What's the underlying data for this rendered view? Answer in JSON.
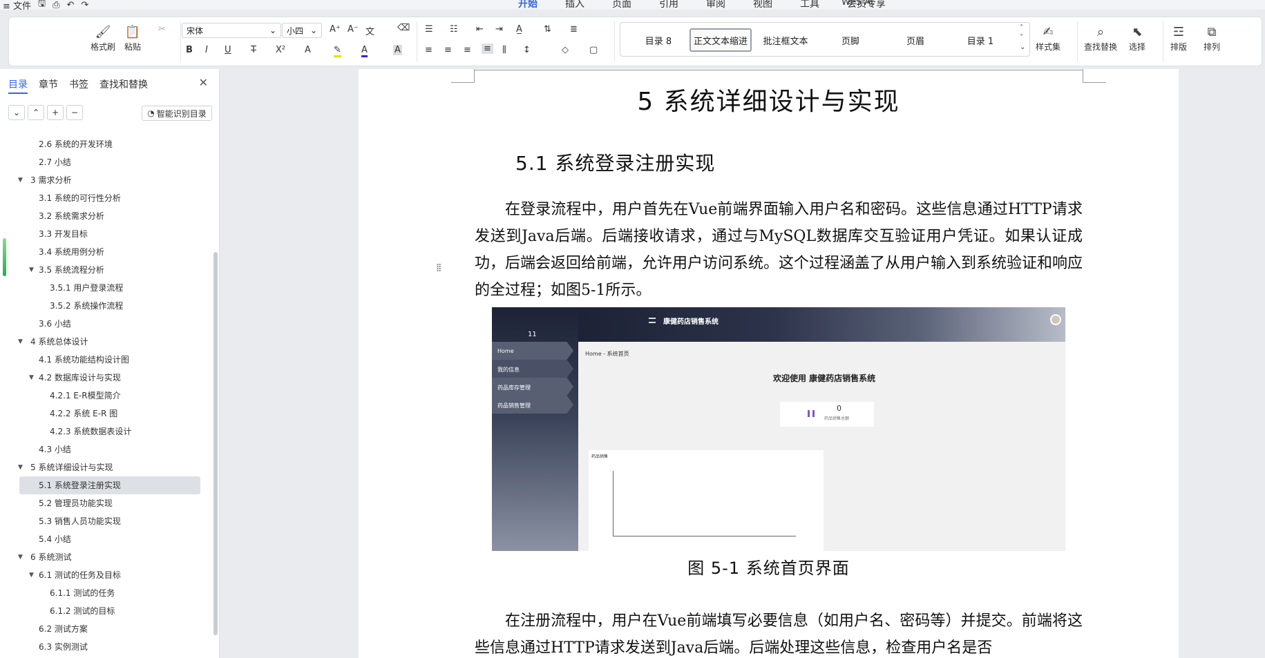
{
  "topbar": {
    "file_menu": "≡ 文件",
    "tabs": [
      "开始",
      "插入",
      "页面",
      "引用",
      "审阅",
      "视图",
      "工具",
      "会员专享"
    ],
    "wps_ai": "WPS AI"
  },
  "ribbon": {
    "format_painter": "格式刷",
    "paste": "粘贴",
    "font_name": "宋体",
    "font_size": "小四",
    "styles": [
      "目录 8",
      "正文文本缩进",
      "批注框文本",
      "页脚",
      "页眉",
      "目录 1"
    ],
    "style_set": "样式集",
    "find_replace": "查找替换",
    "select": "选择",
    "layout": "排版",
    "arrange": "排列"
  },
  "nav": {
    "tabs": [
      "目录",
      "章节",
      "书签",
      "查找和替换"
    ],
    "smart_toc": "智能识别目录",
    "items": [
      {
        "label": "2.6 系统的开发环境",
        "level": 2
      },
      {
        "label": "2.7 小结",
        "level": 2
      },
      {
        "label": "3 需求分析",
        "level": 1
      },
      {
        "label": "3.1 系统的可行性分析",
        "level": 2
      },
      {
        "label": "3.2 系统需求分析",
        "level": 2
      },
      {
        "label": "3.3 开发目标",
        "level": 2
      },
      {
        "label": "3.4  系统用例分析",
        "level": 2
      },
      {
        "label": "3.5 系统流程分析",
        "level": 2
      },
      {
        "label": "3.5.1  用户登录流程",
        "level": 3
      },
      {
        "label": "3.5.2  系统操作流程",
        "level": 3
      },
      {
        "label": "3.6 小结",
        "level": 2
      },
      {
        "label": "4  系统总体设计",
        "level": 1
      },
      {
        "label": "4.1 系统功能结构设计图",
        "level": 2
      },
      {
        "label": "4.2  数据库设计与实现",
        "level": 2
      },
      {
        "label": "4.2.1    E-R模型简介",
        "level": 3
      },
      {
        "label": "4.2.2    系统 E-R 图",
        "level": 3
      },
      {
        "label": "4.2.3  系统数据表设计",
        "level": 3
      },
      {
        "label": "4.3 小结",
        "level": 2
      },
      {
        "label": "5  系统详细设计与实现",
        "level": 1
      },
      {
        "label": "5.1 系统登录注册实现",
        "level": 2
      },
      {
        "label": "5.2 管理员功能实现",
        "level": 2
      },
      {
        "label": "5.3 销售人员功能实现",
        "level": 2
      },
      {
        "label": "5.4  小结",
        "level": 2
      },
      {
        "label": "6  系统测试",
        "level": 1
      },
      {
        "label": "6.1  测试的任务及目标",
        "level": 2
      },
      {
        "label": "6.1.1    测试的任务",
        "level": 3
      },
      {
        "label": "6.1.2    测试的目标",
        "level": 3
      },
      {
        "label": "6.2    测试方案",
        "level": 2
      },
      {
        "label": "6.3    实例测试",
        "level": 2
      }
    ]
  },
  "document": {
    "chapter_title": "5  系统详细设计与实现",
    "section_title": "5.1 系统登录注册实现",
    "paragraph1": "在登录流程中，用户首先在Vue前端界面输入用户名和密码。这些信息通过HTTP请求发送到Java后端。后端接收请求，通过与MySQL数据库交互验证用户凭证。如果认证成功，后端会返回给前端，允许用户访问系统。这个过程涵盖了从用户输入到系统验证和响应的全过程；如图5-1所示。",
    "caption": "图 5-1  系统首页界面",
    "paragraph2": "在注册流程中，用户在Vue前端填写必要信息（如用户名、密码等）并提交。前端将这些信息通过HTTP请求发送到Java后端。后端处理这些信息，检查用户名是否"
  },
  "figure": {
    "app_title": "康健药店销售系统",
    "sidebar_number": "11",
    "menu": [
      "Home",
      "我的信息",
      "药品库存管理",
      "药品销售管理"
    ],
    "breadcrumb": "Home  -  系统首页",
    "welcome": "欢迎使用 康健药店销售系统",
    "card_value": "0",
    "card_label": "药品销售总额",
    "chart_title": "药品销售"
  }
}
